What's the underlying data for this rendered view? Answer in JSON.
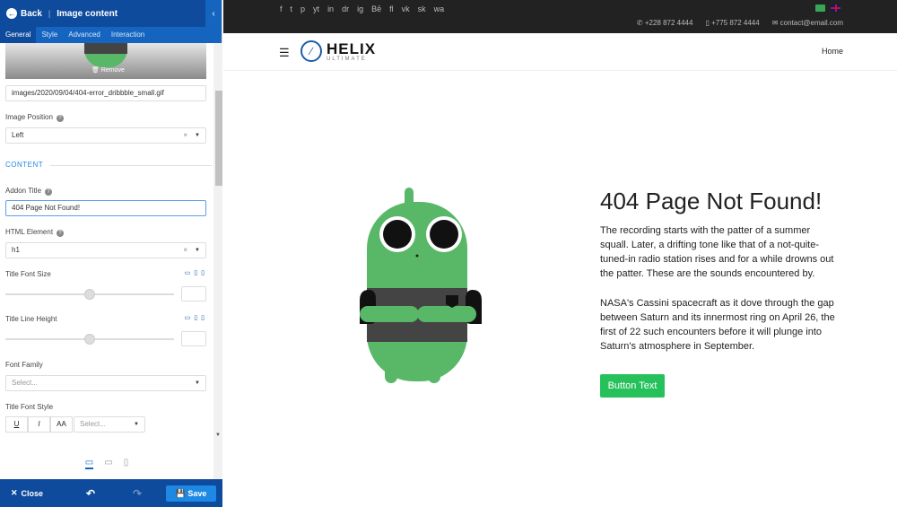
{
  "panel": {
    "back_label": "Back",
    "title": "Image content",
    "tabs": [
      {
        "label": "General"
      },
      {
        "label": "Style"
      },
      {
        "label": "Advanced"
      },
      {
        "label": "Interaction"
      }
    ],
    "remove_label": "Remove",
    "image_path": "images/2020/09/04/404-error_dribbble_small.gif",
    "image_position_label": "Image Position",
    "image_position_value": "Left",
    "content_section": "CONTENT",
    "addon_title_label": "Addon Title",
    "addon_title_value": "404 Page Not Found!",
    "html_element_label": "HTML Element",
    "html_element_value": "h1",
    "title_font_size_label": "Title Font Size",
    "title_line_height_label": "Title Line Height",
    "font_family_label": "Font Family",
    "font_family_placeholder": "Select...",
    "title_font_style_label": "Title Font Style",
    "font_style_buttons": [
      "U",
      "I",
      "AA"
    ],
    "font_style_select_placeholder": "Select...",
    "close_label": "Close",
    "save_label": "Save"
  },
  "site": {
    "socials": [
      "f",
      "t",
      "p",
      "yt",
      "in",
      "dr",
      "ig",
      "Bē",
      "fl",
      "vk",
      "sk",
      "wa"
    ],
    "contacts": {
      "phone": "+228 872 4444",
      "mobile": "+775 872 4444",
      "email": "contact@email.com"
    },
    "logo_main": "HELIX",
    "logo_sub": "ULTIMATE",
    "nav_home": "Home",
    "heading": "404 Page Not Found!",
    "paragraph_1": "The recording starts with the patter of a summer squall. Later, a drifting tone like that of a not-quite-tuned-in radio station rises and for a while drowns out the patter. These are the sounds encountered by.",
    "paragraph_2": "NASA's Cassini spacecraft as it dove through the gap between Saturn and its innermost ring on April 26, the first of 22 such encounters before it will plunge into Saturn's atmosphere in September.",
    "button_label": "Button Text"
  },
  "colors": {
    "panel_header": "#0e4b9d",
    "tab_bar": "#1565c0",
    "accent": "#1e88e5",
    "button_green": "#27c15c",
    "topbar": "#222222",
    "mascot_green": "#58b868"
  }
}
